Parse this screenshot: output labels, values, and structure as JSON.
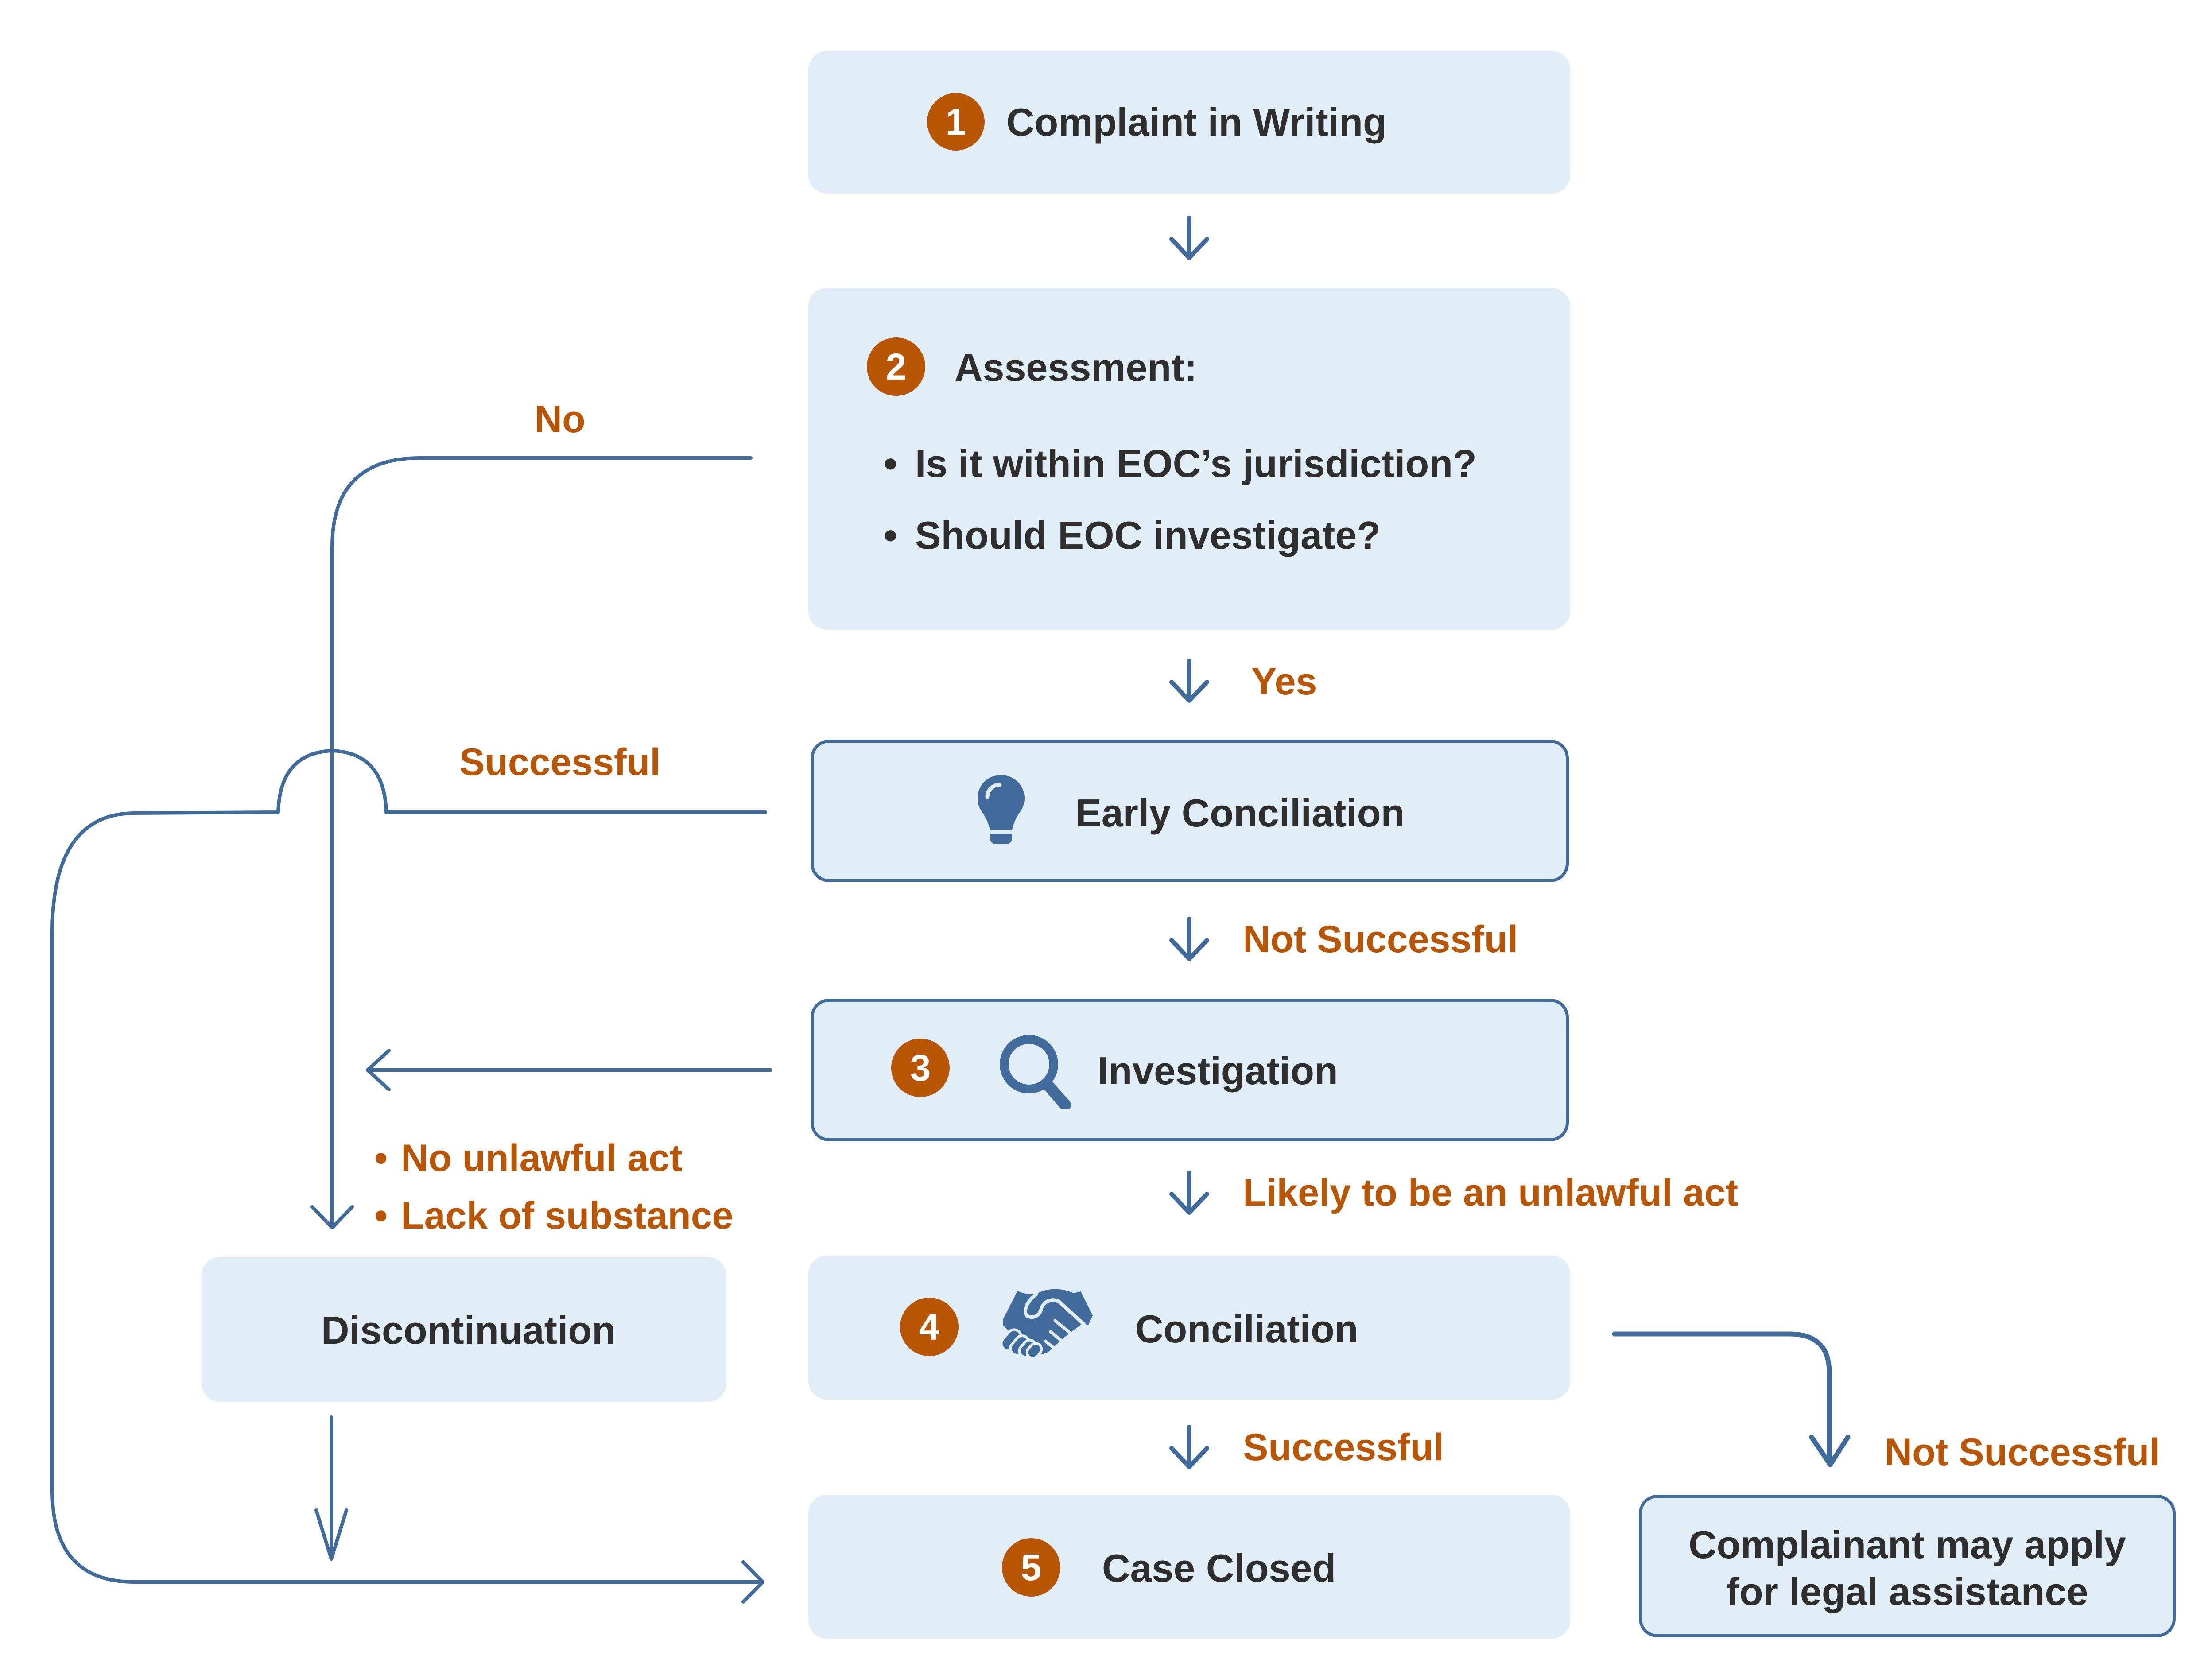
{
  "colors": {
    "box_fill": "#e1eef8",
    "connector": "#416b9a",
    "label_accent": "#b95606",
    "text": "#2e2e2e"
  },
  "steps": {
    "complaint": {
      "number": "1",
      "title": "Complaint in Writing"
    },
    "assessment": {
      "number": "2",
      "title": "Assessment:",
      "bullets": [
        "Is it within EOC’s jurisdiction?",
        "Should EOC investigate?"
      ]
    },
    "early_conciliation": {
      "title": "Early Conciliation",
      "icon": "lightbulb-icon"
    },
    "investigation": {
      "number": "3",
      "title": "Investigation",
      "icon": "magnifier-icon"
    },
    "conciliation": {
      "number": "4",
      "title": "Conciliation",
      "icon": "handshake-icon"
    },
    "case_closed": {
      "number": "5",
      "title": "Case Closed"
    },
    "discontinuation": {
      "title": "Discontinuation"
    },
    "legal_assistance": {
      "line1": "Complainant may apply",
      "line2": "for legal assistance"
    }
  },
  "edge_labels": {
    "assessment_yes": "Yes",
    "assessment_no": "No",
    "early_successful": "Successful",
    "early_not_successful": "Not Successful",
    "investigation_likely": "Likely to be an unlawful act",
    "investigation_reasons": [
      "No unlawful act",
      "Lack of substance"
    ],
    "conciliation_successful": "Successful",
    "conciliation_not_successful": "Not Successful"
  },
  "bullet_glyph": "•"
}
